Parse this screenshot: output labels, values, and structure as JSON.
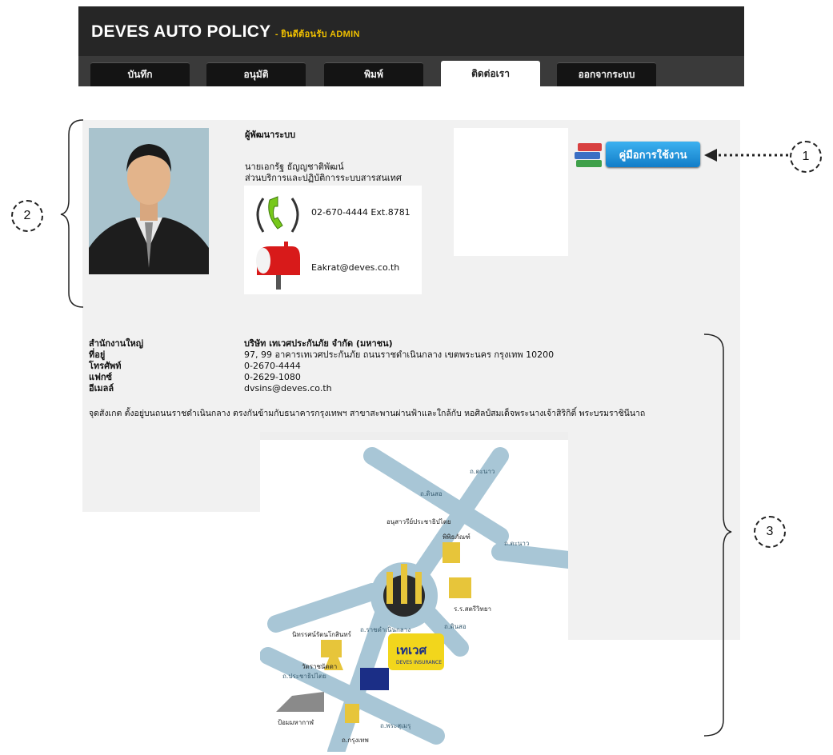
{
  "app": {
    "brand": "DEVES AUTO POLICY",
    "welcome": " - ยินดีต้อนรับ ADMIN"
  },
  "nav": {
    "tabs": [
      {
        "label": "บันทึก"
      },
      {
        "label": "อนุมัติ"
      },
      {
        "label": "พิมพ์"
      },
      {
        "label": "ติดต่อเรา",
        "active": true
      },
      {
        "label": "ออกจากระบบ"
      }
    ]
  },
  "admin": {
    "heading": "ผู้พัฒนาระบบ",
    "name": "นายเอกรัฐ ธัญญชาติพัฒน์",
    "department": "ส่วนบริการและปฏิบัติการระบบสารสนเทศ",
    "phone": "02-670-4444 Ext.8781",
    "email": "Eakrat@deves.co.th"
  },
  "manual_button": {
    "label": "คู่มือการใช้งาน"
  },
  "office": {
    "rows": [
      {
        "label": "สำนักงานใหญ่",
        "value": "บริษัท เทเวศประกันภัย จำกัด (มหาชน)"
      },
      {
        "label": "ที่อยู่",
        "value": "97, 99 อาคารเทเวศประกันภัย ถนนราชดำเนินกลาง เขตพระนคร กรุงเทพ 10200"
      },
      {
        "label": "โทรศัพท์",
        "value": "0-2670-4444"
      },
      {
        "label": "แฟกซ์",
        "value": "0-2629-1080"
      },
      {
        "label": "อีเมลล์",
        "value": "dvsins@deves.co.th"
      }
    ],
    "landmark": "จุดสังเกต ตั้งอยู่บนถนนราชดำเนินกลาง ตรงกันข้ามกับธนาคารกรุงเทพฯ สาขาสะพานผ่านฟ้าและใกล้กับ หอศิลป์สมเด็จพระนางเจ้าสิริกิติ์ พระบรมราชินีนาถ"
  },
  "map": {
    "roads": [
      "ถ.นครสวรรค์",
      "ถ.ราชดำเนินกลาง",
      "ถ.ดินสอ",
      "ถ.ตะนาว",
      "ถ.พระสุเมรุ",
      "ถ.ดินสอ",
      "ถ.ประชาธิปไตย"
    ],
    "road_dinso_top": "ถ.ดินสอ",
    "road_tanao": "ถ.ตะนาว",
    "road_prachathipatai": "ถ.ประชาธิปไตย",
    "road_rajdamnoen": "ถ.ราชดำเนินกลาง",
    "road_phrasumen": "ถ.พระสุเมรุ",
    "road_dinso_right": "ถ.ดินสอ",
    "road_nakhonsawan": "ถ.ตะนาว",
    "road_krung": "ถ.กรุงเทพ",
    "monument": "อนุสาวรีย์ประชาธิปไตย",
    "museum": "พิพิธภัณฑ์",
    "school": "ร.ร.สตรีวิทยา",
    "hall": "นิทรรศน์รัตนโกสินทร์",
    "temple": "วัดราชนัดดา",
    "fort": "ป้อมมหากาฬ",
    "deves_logo": "เทเวศ",
    "deves_sub": "DEVES INSURANCE"
  },
  "callouts": {
    "one": "1",
    "two": "2",
    "three": "3"
  },
  "icons": {
    "phone": "phone-icon",
    "mail": "mailbox-icon",
    "books": "books-icon"
  }
}
